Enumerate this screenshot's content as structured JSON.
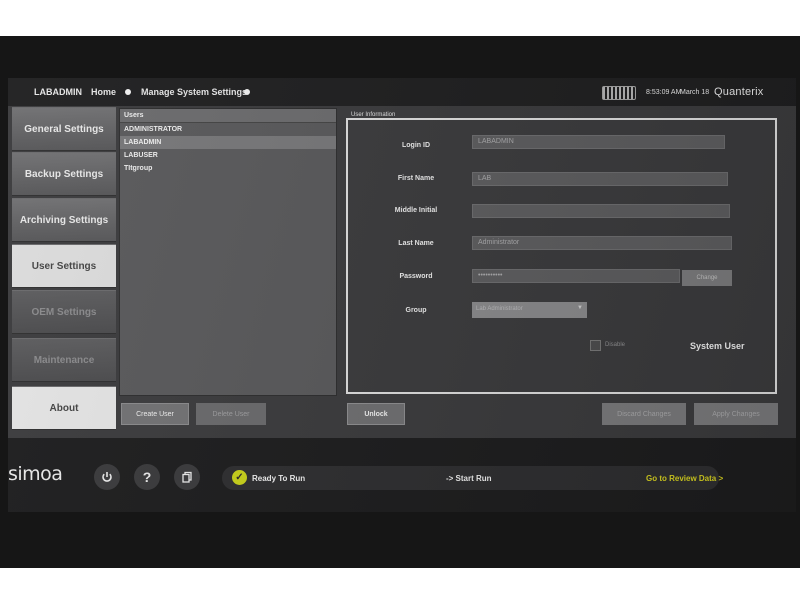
{
  "topbar": {
    "user": "LABADMIN",
    "home": "Home",
    "current_page": "Manage System Settings",
    "time": "8:53:09 AM",
    "date": "March 18",
    "brand": "Quanterix"
  },
  "sidebar": {
    "items": [
      {
        "label": "General Settings",
        "state": "enabled"
      },
      {
        "label": "Backup Settings",
        "state": "enabled"
      },
      {
        "label": "Archiving Settings",
        "state": "enabled"
      },
      {
        "label": "User Settings",
        "state": "active"
      },
      {
        "label": "OEM Settings",
        "state": "disabled"
      },
      {
        "label": "Maintenance",
        "state": "disabled"
      },
      {
        "label": "About",
        "state": "enabled"
      }
    ]
  },
  "users": {
    "header": "Users",
    "rows": [
      "ADMINISTRATOR",
      "LABADMIN",
      "LABUSER",
      "TItgroup"
    ],
    "selected": "LABADMIN"
  },
  "user_info": {
    "title": "User Information",
    "login_id_label": "Login ID",
    "login_id": "LABADMIN",
    "first_name_label": "First Name",
    "first_name": "LAB",
    "middle_initial_label": "Middle Initial",
    "middle_initial": "",
    "last_name_label": "Last Name",
    "last_name": "Administrator",
    "password_label": "Password",
    "password": "••••••••••",
    "change_label": "Change",
    "group_label": "Group",
    "group_value": "Lab Administrator",
    "disable_label": "Disable",
    "system_user": "System User"
  },
  "actions": {
    "create_user": "Create User",
    "delete_user": "Delete User",
    "unlock": "Unlock",
    "discard_changes": "Discard Changes",
    "apply_changes": "Apply Changes"
  },
  "bottombar": {
    "logo": "simoa",
    "power_icon": "power-icon",
    "help_icon": "help-icon",
    "help_glyph": "?",
    "copy_icon": "copy-icon",
    "status": "Ready To Run",
    "start_run": "-> Start Run",
    "review": "Go to Review Data >",
    "status_color": "#c9d21a"
  }
}
